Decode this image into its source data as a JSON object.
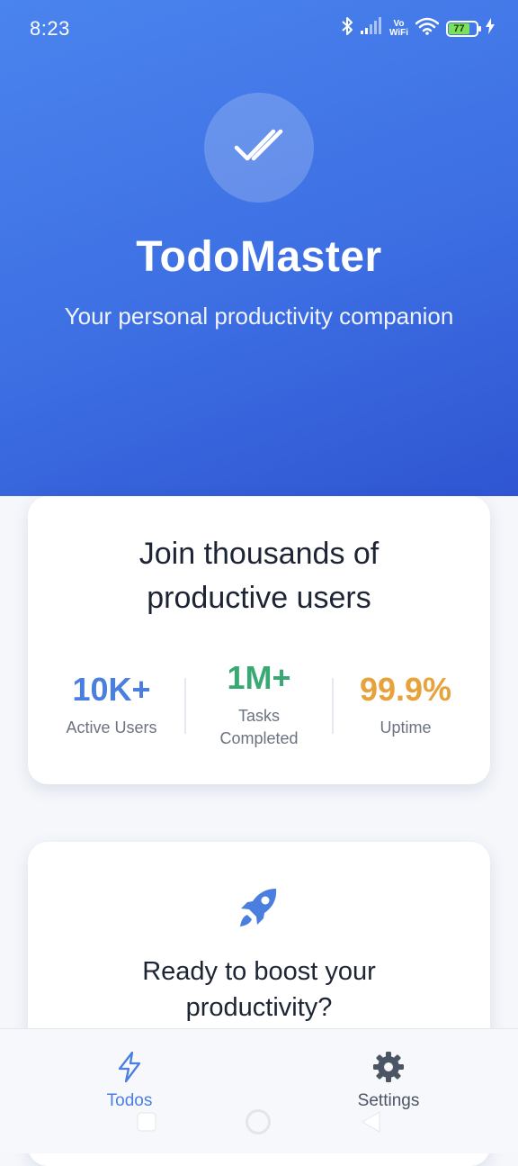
{
  "status_bar": {
    "time": "8:23",
    "network_label_top": "Vo",
    "network_label_bottom": "WiFi",
    "battery": "77"
  },
  "hero": {
    "logo_icon": "double-check-icon",
    "title": "TodoMaster",
    "subtitle": "Your personal productivity companion"
  },
  "stats_card": {
    "heading_line1": "Join thousands of",
    "heading_line2": "productive users",
    "stats": [
      {
        "value": "10K+",
        "label_line1": "Active Users",
        "label_line2": "",
        "color": "#4a7fe0"
      },
      {
        "value": "1M+",
        "label_line1": "Tasks",
        "label_line2": "Completed",
        "color": "#3aa872"
      },
      {
        "value": "99.9%",
        "label_line1": "Uptime",
        "label_line2": "",
        "color": "#e7a23c"
      }
    ]
  },
  "cta_card": {
    "icon": "rocket-icon",
    "heading_line1": "Ready to boost your",
    "heading_line2": "productivity?"
  },
  "bottom_nav": {
    "items": [
      {
        "label": "Todos",
        "icon": "lightning-icon",
        "active": true,
        "color": "#4a7fe0"
      },
      {
        "label": "Settings",
        "icon": "gear-icon",
        "active": false,
        "color": "#4b5563"
      }
    ]
  },
  "colors": {
    "hero_gradient_start": "#4a84ee",
    "hero_gradient_end": "#2f55d2",
    "accent_blue": "#4a7fe0",
    "accent_green": "#3aa872",
    "accent_orange": "#e7a23c"
  }
}
